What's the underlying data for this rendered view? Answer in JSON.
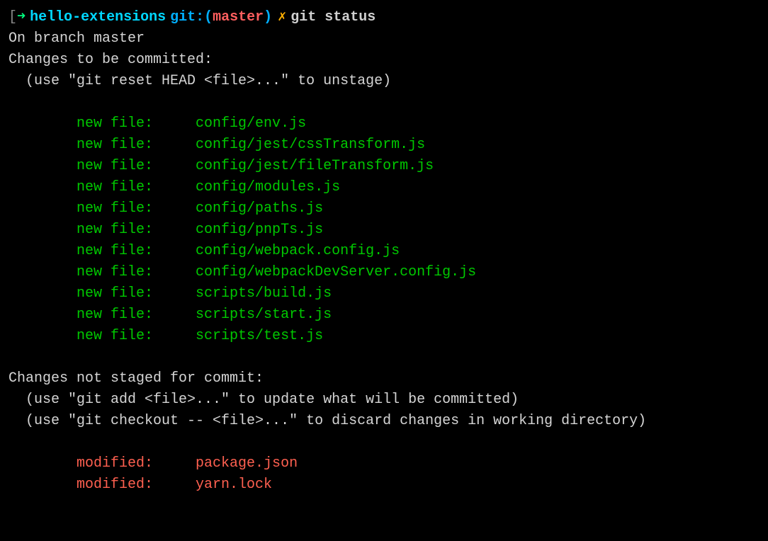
{
  "prompt": {
    "bracket_open": "[",
    "arrow": "➜",
    "directory": "hello-extensions",
    "git_prefix": "git:(",
    "branch": "master",
    "git_suffix": ")",
    "dirty_marker": "✗",
    "command": "git status"
  },
  "output": {
    "branch_line": "On branch master",
    "staged_header": "Changes to be committed:",
    "staged_hint": "  (use \"git reset HEAD <file>...\" to unstage)",
    "unstaged_header": "Changes not staged for commit:",
    "unstaged_hint1": "  (use \"git add <file>...\" to update what will be committed)",
    "unstaged_hint2": "  (use \"git checkout -- <file>...\" to discard changes in working directory)"
  },
  "staged_files": [
    {
      "status": "new file:",
      "path": "config/env.js"
    },
    {
      "status": "new file:",
      "path": "config/jest/cssTransform.js"
    },
    {
      "status": "new file:",
      "path": "config/jest/fileTransform.js"
    },
    {
      "status": "new file:",
      "path": "config/modules.js"
    },
    {
      "status": "new file:",
      "path": "config/paths.js"
    },
    {
      "status": "new file:",
      "path": "config/pnpTs.js"
    },
    {
      "status": "new file:",
      "path": "config/webpack.config.js"
    },
    {
      "status": "new file:",
      "path": "config/webpackDevServer.config.js"
    },
    {
      "status": "new file:",
      "path": "scripts/build.js"
    },
    {
      "status": "new file:",
      "path": "scripts/start.js"
    },
    {
      "status": "new file:",
      "path": "scripts/test.js"
    }
  ],
  "unstaged_files": [
    {
      "status": "modified:",
      "path": "package.json"
    },
    {
      "status": "modified:",
      "path": "yarn.lock"
    }
  ]
}
